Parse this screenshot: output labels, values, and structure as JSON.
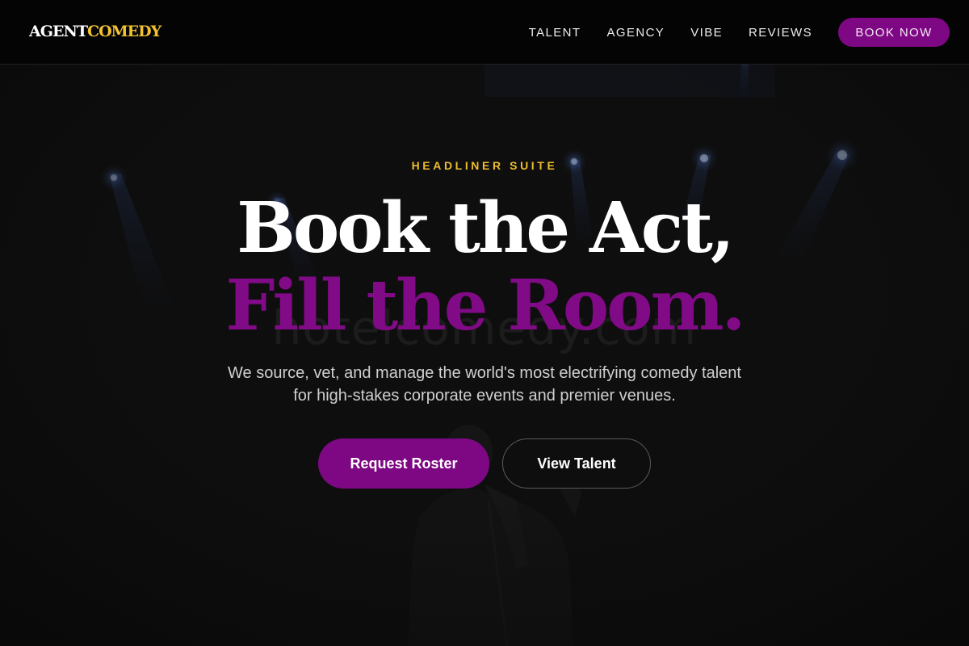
{
  "brand": {
    "logo_part_1": "AGENT",
    "logo_part_2": "COMEDY",
    "accent_gold": "#f2c230",
    "accent_purple": "#7e0883"
  },
  "nav": {
    "links": [
      "TALENT",
      "AGENCY",
      "VIBE",
      "REVIEWS"
    ],
    "cta_label": "BOOK NOW"
  },
  "hero": {
    "eyebrow": "HEADLINER SUITE",
    "headline_line_1": "Book the Act,",
    "headline_line_2": "Fill the Room.",
    "subtext": "We source, vet, and manage the world's most electrifying comedy talent for high-stakes corporate events and premier venues.",
    "primary_button": "Request Roster",
    "secondary_button": "View Talent",
    "watermark": "hotelcomedy.com",
    "background_image": "stage-spotlights-performer"
  }
}
